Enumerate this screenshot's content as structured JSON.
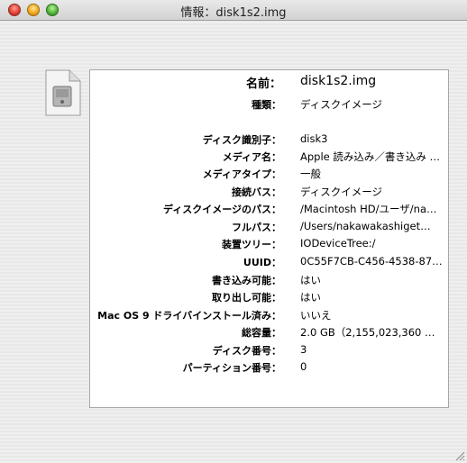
{
  "window": {
    "title": "情報：disk1s2.img"
  },
  "icon": "disk-image-document-icon",
  "info": [
    {
      "label": "名前：",
      "value": "disk1s2.img"
    },
    {
      "label": "種類：",
      "value": "ディスクイメージ"
    },
    {
      "label": "ディスク識別子：",
      "value": "disk3"
    },
    {
      "label": "メディア名：",
      "value": "Apple 読み込み／書き込み Media"
    },
    {
      "label": "メディアタイプ：",
      "value": "一般"
    },
    {
      "label": "接続バス：",
      "value": "ディスクイメージ"
    },
    {
      "label": "ディスクイメージのパス：",
      "value": "/Macintosh HD/ユーザ/na…"
    },
    {
      "label": "フルパス：",
      "value": "/Users/nakawakashiget…"
    },
    {
      "label": "装置ツリー：",
      "value": "IODeviceTree:/"
    },
    {
      "label": "UUID：",
      "value": "0C55F7CB-C456-4538-87…"
    },
    {
      "label": "書き込み可能：",
      "value": "はい"
    },
    {
      "label": "取り出し可能：",
      "value": "はい"
    },
    {
      "label": "Mac OS 9 ドライバインストール済み：",
      "value": "いいえ"
    },
    {
      "label": "総容量：",
      "value": "2.0 GB（2,155,023,360 …"
    },
    {
      "label": "ディスク番号：",
      "value": "3"
    },
    {
      "label": "パーティション番号：",
      "value": "0"
    }
  ]
}
